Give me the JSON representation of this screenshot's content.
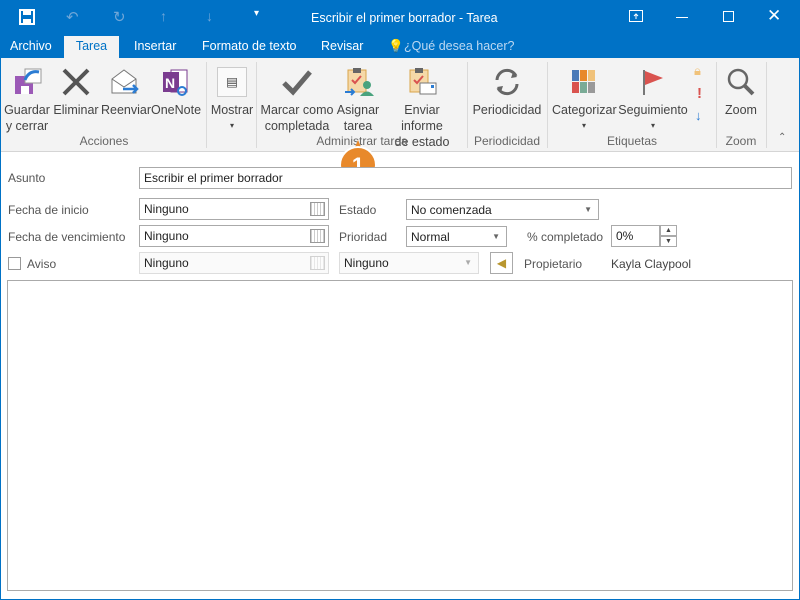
{
  "window": {
    "title": "Escribir el primer borrador - Tarea"
  },
  "qat": {
    "save": "save-icon",
    "undo": "undo-icon",
    "redo": "redo-icon",
    "up": "up-arrow-icon",
    "down": "down-arrow-icon",
    "customize": "customize-icon"
  },
  "tabs": [
    {
      "label": "Archivo"
    },
    {
      "label": "Tarea"
    },
    {
      "label": "Insertar"
    },
    {
      "label": "Formato de texto"
    },
    {
      "label": "Revisar"
    }
  ],
  "tell_me": "¿Qué desea hacer?",
  "ribbon": {
    "save_close": [
      "Guardar",
      "y cerrar"
    ],
    "delete": "Eliminar",
    "forward": "Reenviar",
    "onenote": "OneNote",
    "group_actions": "Acciones",
    "show": "Mostrar",
    "mark_complete": [
      "Marcar como",
      "completada"
    ],
    "assign": [
      "Asignar",
      "tarea"
    ],
    "send_status": [
      "Enviar informe",
      "de estado"
    ],
    "group_manage": "Administrar tarea",
    "recurrence": "Periodicidad",
    "group_recurrence": "Periodicidad",
    "categorize": "Categorizar",
    "followup": "Seguimiento",
    "group_tags": "Etiquetas",
    "zoom": "Zoom",
    "group_zoom": "Zoom"
  },
  "callout": {
    "number": "1",
    "color": "#e8892b"
  },
  "form": {
    "subject_label": "Asunto",
    "subject": "Escribir el primer borrador",
    "start_label": "Fecha de inicio",
    "start": "Ninguno",
    "due_label": "Fecha de vencimiento",
    "due": "Ninguno",
    "reminder_label": "Aviso",
    "reminder_date": "Ninguno",
    "reminder_time": "Ninguno",
    "reminder_checked": false,
    "status_label": "Estado",
    "status": "No comenzada",
    "priority_label": "Prioridad",
    "priority": "Normal",
    "percent_label": "% completado",
    "percent": "0%",
    "owner_label": "Propietario",
    "owner": "Kayla Claypool"
  },
  "colors": {
    "accent": "#0072c6"
  }
}
